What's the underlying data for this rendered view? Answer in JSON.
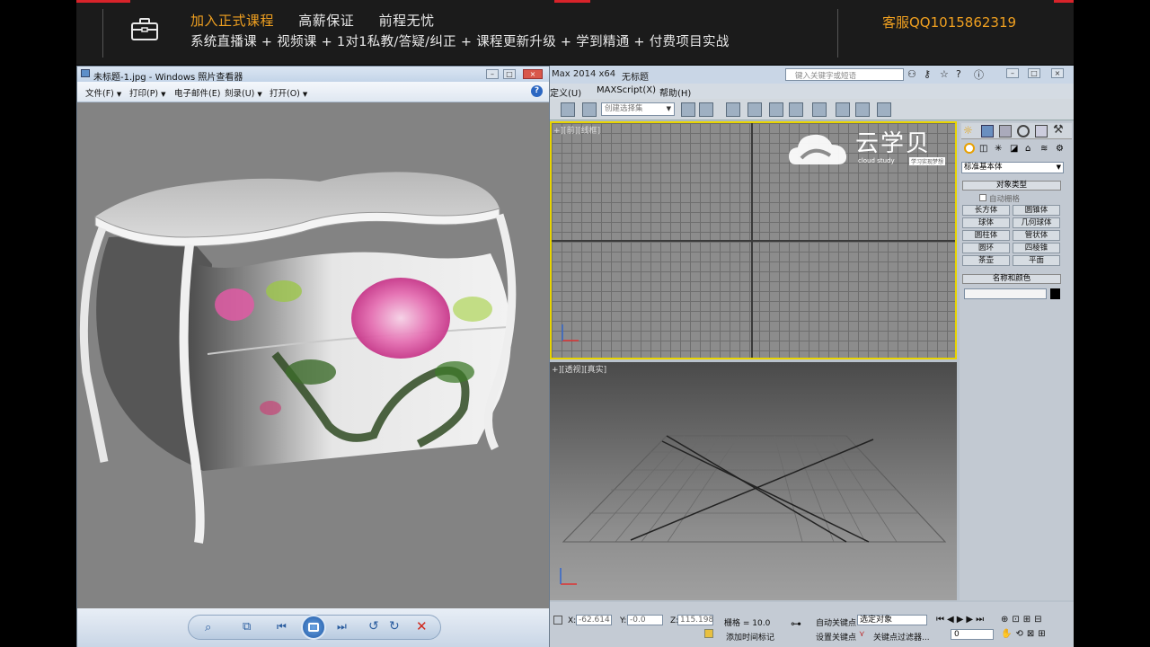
{
  "banner": {
    "promo_line1": [
      "加入正式课程",
      "高薪保证",
      "前程无忧"
    ],
    "promo_line2": "系统直播课 + 视频课 + 1对1私教/答疑/纠正 + 课程更新升级 + 学到精通 + 付费项目实战",
    "qq_label": "客服QQ1015862319"
  },
  "viewer": {
    "title": "未标题-1.jpg - Windows 照片查看器",
    "menu": [
      {
        "label": "文件(F)"
      },
      {
        "label": "打印(P)"
      },
      {
        "label": "电子邮件(E)"
      },
      {
        "label": "刻录(U)"
      },
      {
        "label": "打开(O)"
      }
    ],
    "help_icon": "help-icon",
    "controls": [
      "zoom-icon",
      "fit-window-icon",
      "previous-icon",
      "slideshow-icon",
      "next-icon",
      "rotate-ccw-icon",
      "rotate-cw-icon",
      "delete-icon"
    ]
  },
  "max": {
    "title_left": "Max 2014 x64",
    "title_doc": "无标题",
    "search_placeholder": "键入关键字或短语",
    "menu": [
      "定义(U)",
      "MAXScript(X)",
      "帮助(H)"
    ],
    "selection_set_placeholder": "创建选择集",
    "viewport_top_label": "+][前][线框]",
    "viewport_persp_label": "+][透视][真实]",
    "watermark_text": "云学贝",
    "watermark_sub": "cloud study",
    "watermark_sub2": "学习实现梦想",
    "command_panel": {
      "dropdown": "标准基本体",
      "rollout_object_type": "对象类型",
      "autogrid": "自动栅格",
      "buttons": [
        "长方体",
        "圆锥体",
        "球体",
        "几何球体",
        "圆柱体",
        "管状体",
        "圆环",
        "四棱锥",
        "茶壶",
        "平面"
      ],
      "rollout_name_color": "名称和颜色"
    },
    "status": {
      "x_label": "X:",
      "x_value": "-62.614",
      "y_label": "Y:",
      "y_value": "-0.0",
      "z_label": "Z:",
      "z_value": "115.198",
      "grid": "栅格 = 10.0",
      "auto_key": "自动关键点",
      "select_object": "选定对象",
      "set_key": "设置关键点",
      "key_filter": "关键点过滤器...",
      "add_time_tag": "添加时间标记",
      "frame": "0"
    }
  },
  "colors": {
    "banner_bg": "#1b1b1b",
    "banner_accent": "#f0a020",
    "viewport_active_border": "#e8d400"
  }
}
